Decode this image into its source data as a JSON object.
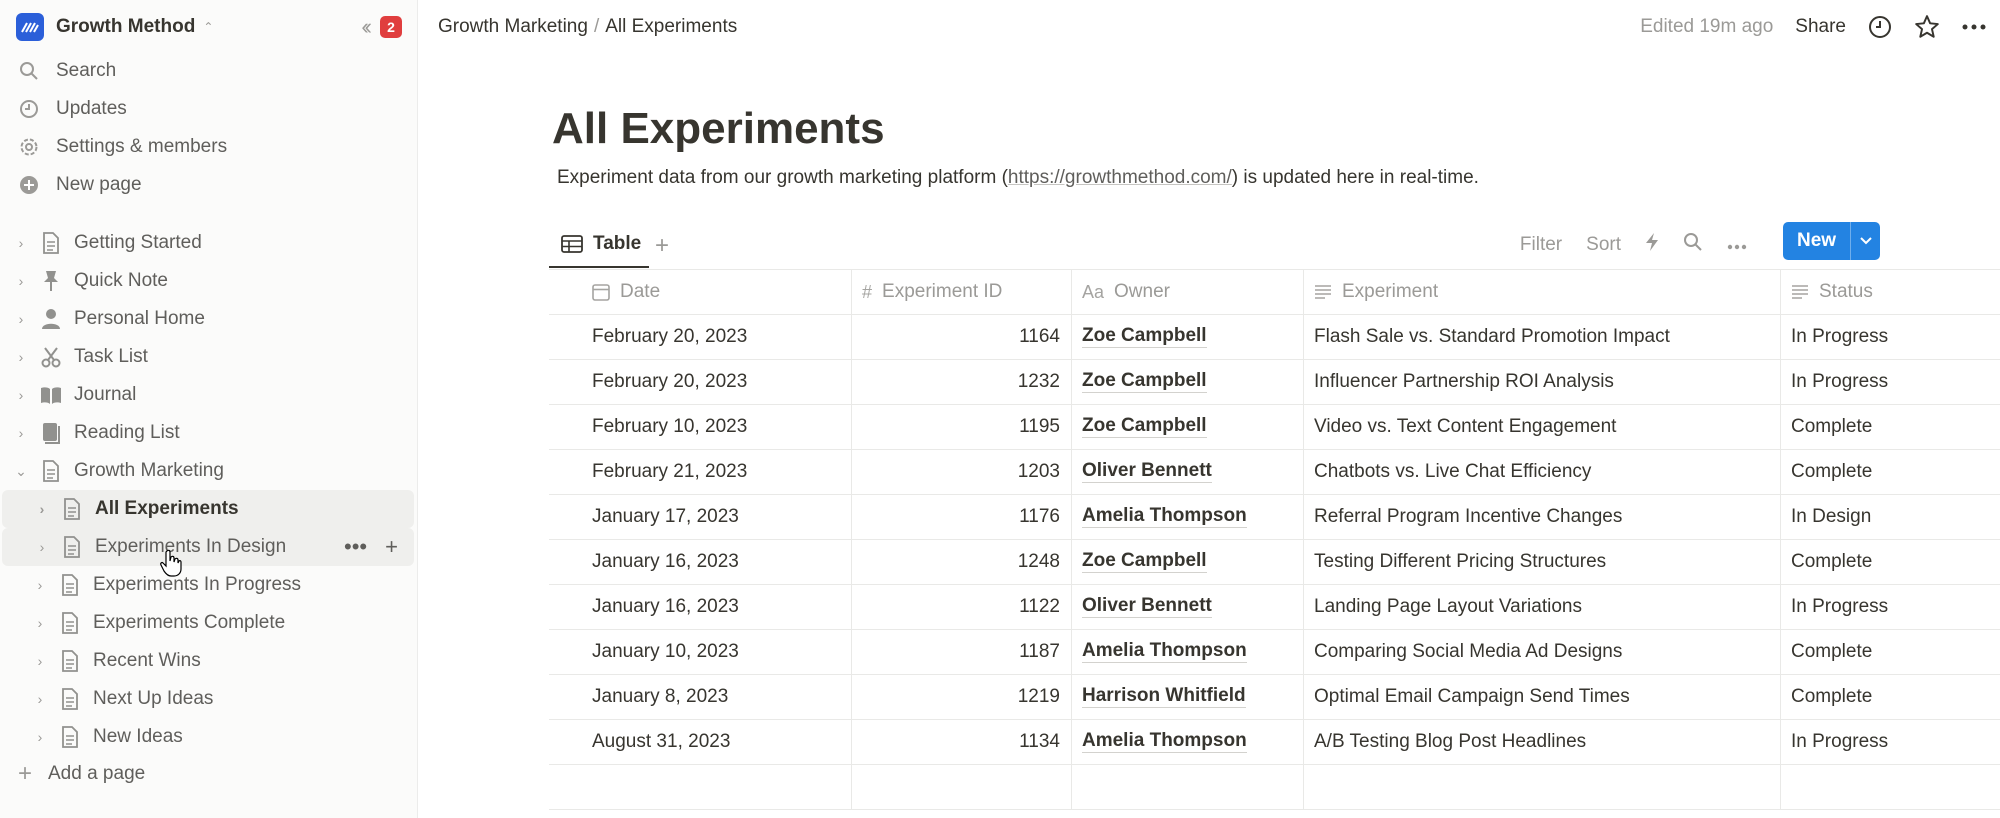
{
  "workspace": {
    "name": "Growth Method",
    "notifications": "2"
  },
  "sidebar": {
    "nav": [
      {
        "label": "Search",
        "icon": "search-icon"
      },
      {
        "label": "Updates",
        "icon": "clock-icon"
      },
      {
        "label": "Settings & members",
        "icon": "gear-icon"
      },
      {
        "label": "New page",
        "icon": "plus-circle-icon"
      }
    ],
    "pages": [
      {
        "label": "Getting Started",
        "icon": "document-icon"
      },
      {
        "label": "Quick Note",
        "icon": "pin-icon"
      },
      {
        "label": "Personal Home",
        "icon": "person-icon"
      },
      {
        "label": "Task List",
        "icon": "scissors-icon"
      },
      {
        "label": "Journal",
        "icon": "book-icon"
      },
      {
        "label": "Reading List",
        "icon": "books-icon"
      },
      {
        "label": "Growth Marketing",
        "icon": "document-icon"
      }
    ],
    "children": [
      {
        "label": "All Experiments"
      },
      {
        "label": "Experiments In Design"
      },
      {
        "label": "Experiments In Progress"
      },
      {
        "label": "Experiments Complete"
      },
      {
        "label": "Recent Wins"
      },
      {
        "label": "Next Up Ideas"
      },
      {
        "label": "New Ideas"
      }
    ],
    "add_page": "Add a page"
  },
  "topbar": {
    "crumb_parent": "Growth Marketing",
    "crumb_sep": "/",
    "crumb_current": "All Experiments",
    "edited": "Edited 19m ago",
    "share": "Share"
  },
  "page": {
    "title": "All Experiments",
    "desc_before": "Experiment data from our growth marketing platform (",
    "desc_link": "https://growthmethod.com/",
    "desc_after": ") is updated here in real-time."
  },
  "view": {
    "tab_label": "Table",
    "filter": "Filter",
    "sort": "Sort",
    "new_label": "New"
  },
  "table": {
    "headers": {
      "date": "Date",
      "id": "Experiment ID",
      "owner": "Owner",
      "owner_prefix": "Aa",
      "experiment": "Experiment",
      "status": "Status"
    },
    "rows": [
      {
        "date": "February 20, 2023",
        "id": "1164",
        "owner": "Zoe Campbell",
        "experiment": "Flash Sale vs. Standard Promotion Impact",
        "status": "In Progress"
      },
      {
        "date": "February 20, 2023",
        "id": "1232",
        "owner": "Zoe Campbell",
        "experiment": "Influencer Partnership ROI Analysis",
        "status": "In Progress"
      },
      {
        "date": "February 10, 2023",
        "id": "1195",
        "owner": "Zoe Campbell",
        "experiment": "Video vs. Text Content Engagement",
        "status": "Complete"
      },
      {
        "date": "February 21, 2023",
        "id": "1203",
        "owner": "Oliver Bennett",
        "experiment": "Chatbots vs. Live Chat Efficiency",
        "status": "Complete"
      },
      {
        "date": "January 17, 2023",
        "id": "1176",
        "owner": "Amelia Thompson",
        "experiment": "Referral Program Incentive Changes",
        "status": "In Design"
      },
      {
        "date": "January 16, 2023",
        "id": "1248",
        "owner": "Zoe Campbell",
        "experiment": "Testing Different Pricing Structures",
        "status": "Complete"
      },
      {
        "date": "January 16, 2023",
        "id": "1122",
        "owner": "Oliver Bennett",
        "experiment": "Landing Page Layout Variations",
        "status": "In Progress"
      },
      {
        "date": "January 10, 2023",
        "id": "1187",
        "owner": "Amelia Thompson",
        "experiment": "Comparing Social Media Ad Designs",
        "status": "Complete"
      },
      {
        "date": "January 8, 2023",
        "id": "1219",
        "owner": "Harrison Whitfield",
        "experiment": "Optimal Email Campaign Send Times",
        "status": "Complete"
      },
      {
        "date": "August 31, 2023",
        "id": "1134",
        "owner": "Amelia Thompson",
        "experiment": "A/B Testing Blog Post Headlines",
        "status": "In Progress"
      }
    ]
  },
  "colors": {
    "accent": "#2383e2",
    "badge": "#e03e3e",
    "logo": "#2b5fd9"
  }
}
